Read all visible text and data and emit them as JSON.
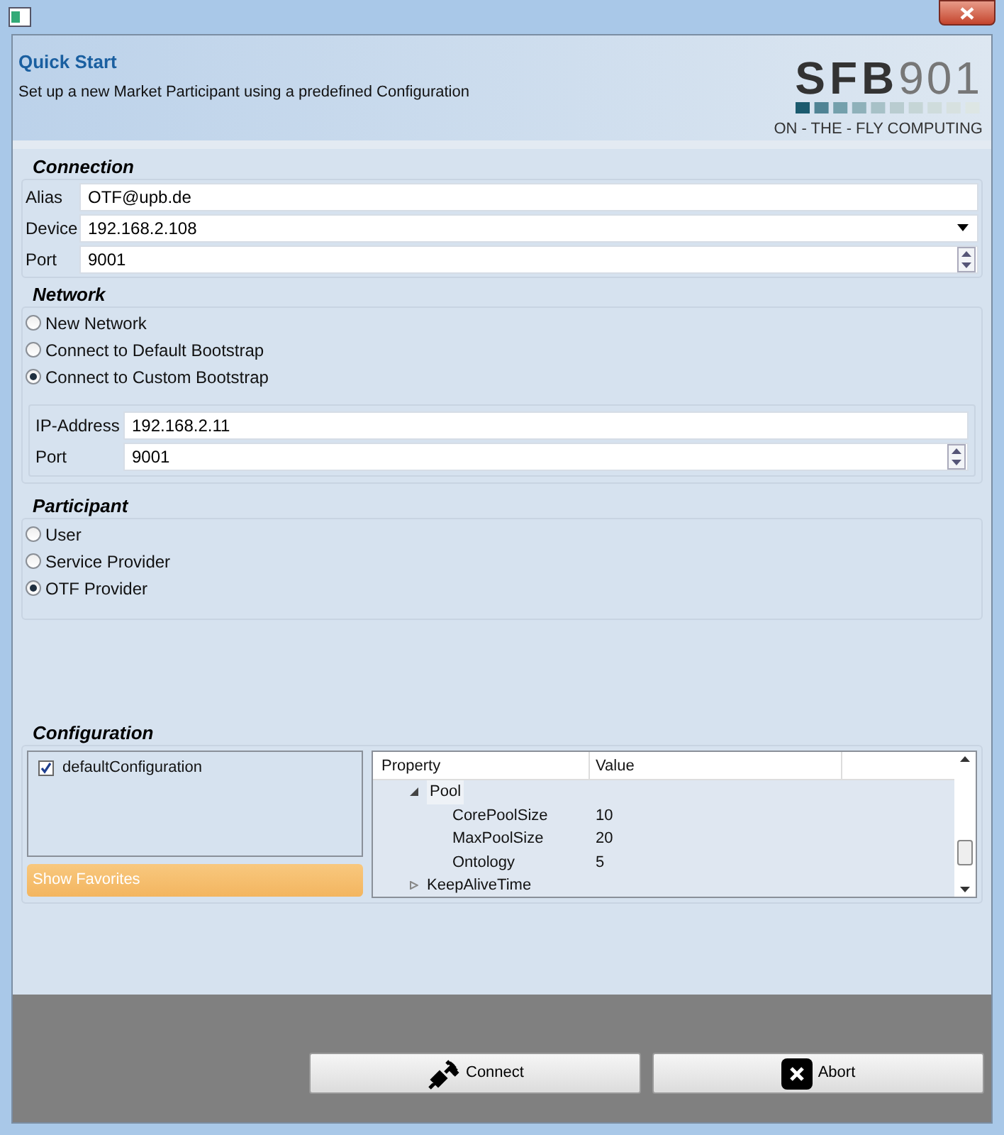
{
  "header": {
    "title": "Quick Start",
    "subtitle": "Set up a new Market Participant using a predefined Configuration",
    "logo": {
      "letters": "SFB",
      "number": "901",
      "tagline": "ON - THE - FLY COMPUTING"
    }
  },
  "connection": {
    "title": "Connection",
    "fields": [
      {
        "kind": "text",
        "label": "Alias",
        "value": "OTF@upb.de"
      },
      {
        "kind": "dropdown",
        "label": "Device",
        "value": "192.168.2.108"
      },
      {
        "kind": "spinner",
        "label": "Port",
        "value": "9001"
      }
    ]
  },
  "network": {
    "title": "Network",
    "options": [
      {
        "label": "New Network",
        "selected": false
      },
      {
        "label": "Connect to Default Bootstrap",
        "selected": false
      },
      {
        "label": "Connect to Custom Bootstrap",
        "selected": true
      }
    ],
    "custom": {
      "fields": [
        {
          "kind": "text",
          "label": "IP-Address",
          "value": "192.168.2.11"
        },
        {
          "kind": "spinner",
          "label": "Port",
          "value": "9001"
        }
      ]
    }
  },
  "participant": {
    "title": "Participant",
    "options": [
      {
        "label": "User",
        "selected": false
      },
      {
        "label": "Service Provider",
        "selected": false
      },
      {
        "label": "OTF Provider",
        "selected": true
      }
    ]
  },
  "configuration": {
    "title": "Configuration",
    "list": [
      {
        "label": "defaultConfiguration",
        "checked": true
      }
    ],
    "favorites_button": "Show Favorites",
    "table": {
      "columns": [
        "Property",
        "Value"
      ],
      "rows": [
        {
          "property": "Pool",
          "expanded": true,
          "children": [
            {
              "property": "CorePoolSize",
              "value": "10"
            },
            {
              "property": "MaxPoolSize",
              "value": "20"
            },
            {
              "property": "Ontology",
              "value": "5"
            }
          ]
        },
        {
          "property": "KeepAliveTime",
          "expanded": false
        }
      ]
    }
  },
  "buttons": [
    {
      "kind": "connect",
      "label": "Connect"
    },
    {
      "kind": "abort",
      "label": "Abort"
    }
  ]
}
